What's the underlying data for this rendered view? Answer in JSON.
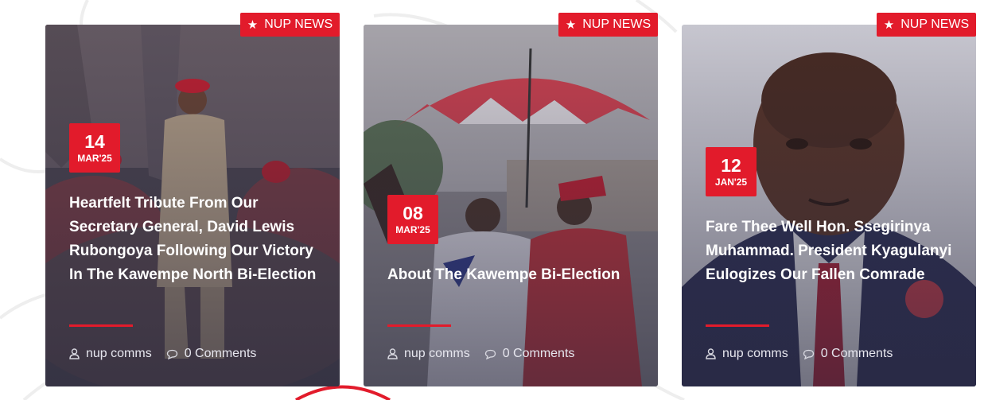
{
  "cards": [
    {
      "tag": "NUP NEWS",
      "day": "14",
      "month": "MAR'25",
      "title": "Heartfelt Tribute From Our Secretary General, David Lewis Rubongoya Following Our Victory In The Kawempe North Bi-Election",
      "author": "nup comms",
      "comments": "0 Comments"
    },
    {
      "tag": "NUP NEWS",
      "day": "08",
      "month": "MAR'25",
      "title": "About The Kawempe Bi-Election",
      "author": "nup comms",
      "comments": "0 Comments"
    },
    {
      "tag": "NUP NEWS",
      "day": "12",
      "month": "JAN'25",
      "title": "Fare Thee Well Hon. Ssegirinya Muhammad. President Kyagulanyi Eulogizes Our Fallen Comrade",
      "author": "nup comms",
      "comments": "0 Comments"
    }
  ],
  "icons": {
    "tag": "star-icon",
    "author": "user-icon",
    "comments": "comment-icon"
  },
  "colors": {
    "accent": "#e21b2b",
    "text_on_image": "#ffffff"
  }
}
